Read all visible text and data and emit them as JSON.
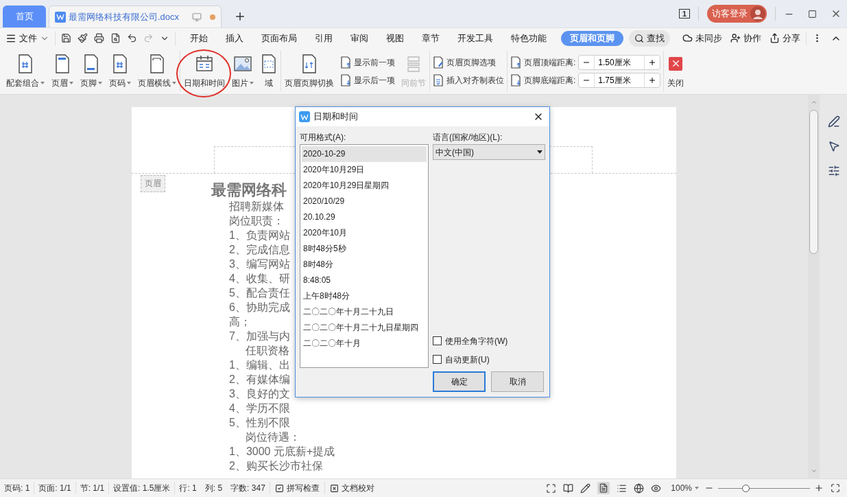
{
  "document_tabs": [
    {
      "label": "首页",
      "kind": "home",
      "selected": false
    },
    {
      "label": "最需网络科技有限公司.docx",
      "kind": "document",
      "selected": true,
      "unsaved": true
    }
  ],
  "page_indicator": "1",
  "account": {
    "label": "访客登录"
  },
  "menu": {
    "file": "文件",
    "tabs": [
      {
        "label": "开始",
        "selected": false
      },
      {
        "label": "插入",
        "selected": false
      },
      {
        "label": "页面布局",
        "selected": false
      },
      {
        "label": "引用",
        "selected": false
      },
      {
        "label": "审阅",
        "selected": false
      },
      {
        "label": "视图",
        "selected": false
      },
      {
        "label": "章节",
        "selected": false
      },
      {
        "label": "开发工具",
        "selected": false
      },
      {
        "label": "特色功能",
        "selected": false
      },
      {
        "label": "页眉和页脚",
        "selected": true
      }
    ],
    "search": "查找",
    "actions": [
      "未同步",
      "协作",
      "分享"
    ]
  },
  "ribbon": {
    "header_footer_group": [
      {
        "label": "配套组合",
        "dropdown": true
      },
      {
        "label": "页眉",
        "dropdown": true
      },
      {
        "label": "页脚",
        "dropdown": true
      },
      {
        "label": "页码",
        "dropdown": true
      },
      {
        "label": "页眉横线",
        "dropdown": true
      }
    ],
    "insert_group": [
      {
        "label": "日期和时间",
        "dropdown": false,
        "circled": true
      },
      {
        "label": "图片",
        "dropdown": true,
        "circled": false
      },
      {
        "label": "域",
        "dropdown": false,
        "circled": false
      }
    ],
    "navigation_group": {
      "switch": "页眉页脚切换",
      "show_previous": "显示前一项",
      "show_next": "显示后一项",
      "same_as_previous": {
        "label": "同前节",
        "disabled": true
      }
    },
    "options_group": [
      "页眉页脚选项",
      "插入对齐制表位"
    ],
    "distances": [
      {
        "label": "页眉顶端距离:",
        "value": "1.50厘米"
      },
      {
        "label": "页脚底端距离:",
        "value": "1.75厘米"
      }
    ],
    "close": "关闭"
  },
  "document": {
    "header_tag": "页眉",
    "title": "最需网络科",
    "lines": [
      {
        "text": "招聘新媒体",
        "kind": "plain"
      },
      {
        "text": "岗位职责：",
        "kind": "plain"
      },
      {
        "text": "1、负责网站",
        "kind": "plain"
      },
      {
        "text": "2、完成信息",
        "kind": "plain"
      },
      {
        "text": "3、编写网站",
        "kind": "plain"
      },
      {
        "text": "4、收集、研",
        "kind": "plain"
      },
      {
        "text": "5、配合责任",
        "kind": "plain"
      },
      {
        "text": "6、协助完成",
        "kind": "plain"
      },
      {
        "text": "高；",
        "kind": "plain"
      },
      {
        "text": "7、加强与内",
        "kind": "plain"
      },
      {
        "text": "任职资格",
        "kind": "indented"
      },
      {
        "text": "1、编辑、出",
        "kind": "plain"
      },
      {
        "text": "2、有媒体编",
        "kind": "plain"
      },
      {
        "text": "3、良好的文",
        "kind": "plain"
      },
      {
        "text": "4、学历不限",
        "kind": "plain"
      },
      {
        "text": "5、性别不限",
        "kind": "plain"
      },
      {
        "text": "岗位待遇：",
        "kind": "indented"
      },
      {
        "text": "1、3000 元底薪+提成",
        "kind": "plain"
      },
      {
        "text": "2、购买长沙市社保",
        "kind": "plain"
      }
    ]
  },
  "dialog": {
    "title": "日期和时间",
    "formats_label": "可用格式(A):",
    "formats": [
      {
        "text": "2020-10-29",
        "selected": true
      },
      {
        "text": "2020年10月29日",
        "selected": false
      },
      {
        "text": "2020年10月29日星期四",
        "selected": false
      },
      {
        "text": "2020/10/29",
        "selected": false
      },
      {
        "text": "20.10.29",
        "selected": false
      },
      {
        "text": "2020年10月",
        "selected": false
      },
      {
        "text": "8时48分5秒",
        "selected": false
      },
      {
        "text": "8时48分",
        "selected": false
      },
      {
        "text": "8:48:05",
        "selected": false
      },
      {
        "text": "上午8时48分",
        "selected": false
      },
      {
        "text": "二〇二〇年十月二十九日",
        "selected": false
      },
      {
        "text": "二〇二〇年十月二十九日星期四",
        "selected": false
      },
      {
        "text": "二〇二〇年十月",
        "selected": false
      }
    ],
    "language_label": "语言(国家/地区)(L):",
    "language": "中文(中国)",
    "checkboxes": [
      {
        "label": "使用全角字符(W)",
        "checked": false
      },
      {
        "label": "自动更新(U)",
        "checked": false
      }
    ],
    "buttons": [
      {
        "label": "确定",
        "default": true
      },
      {
        "label": "取消",
        "default": false
      }
    ]
  },
  "status_bar": {
    "items": [
      "页码: 1",
      "页面: 1/1",
      "节: 1/1",
      "设置值: 1.5厘米",
      "行: 1",
      "列: 5",
      "字数: 347"
    ],
    "tools": [
      "拼写检查",
      "文档校对"
    ],
    "zoom": "100%",
    "zoom_slider": {
      "level": 0.3
    }
  }
}
